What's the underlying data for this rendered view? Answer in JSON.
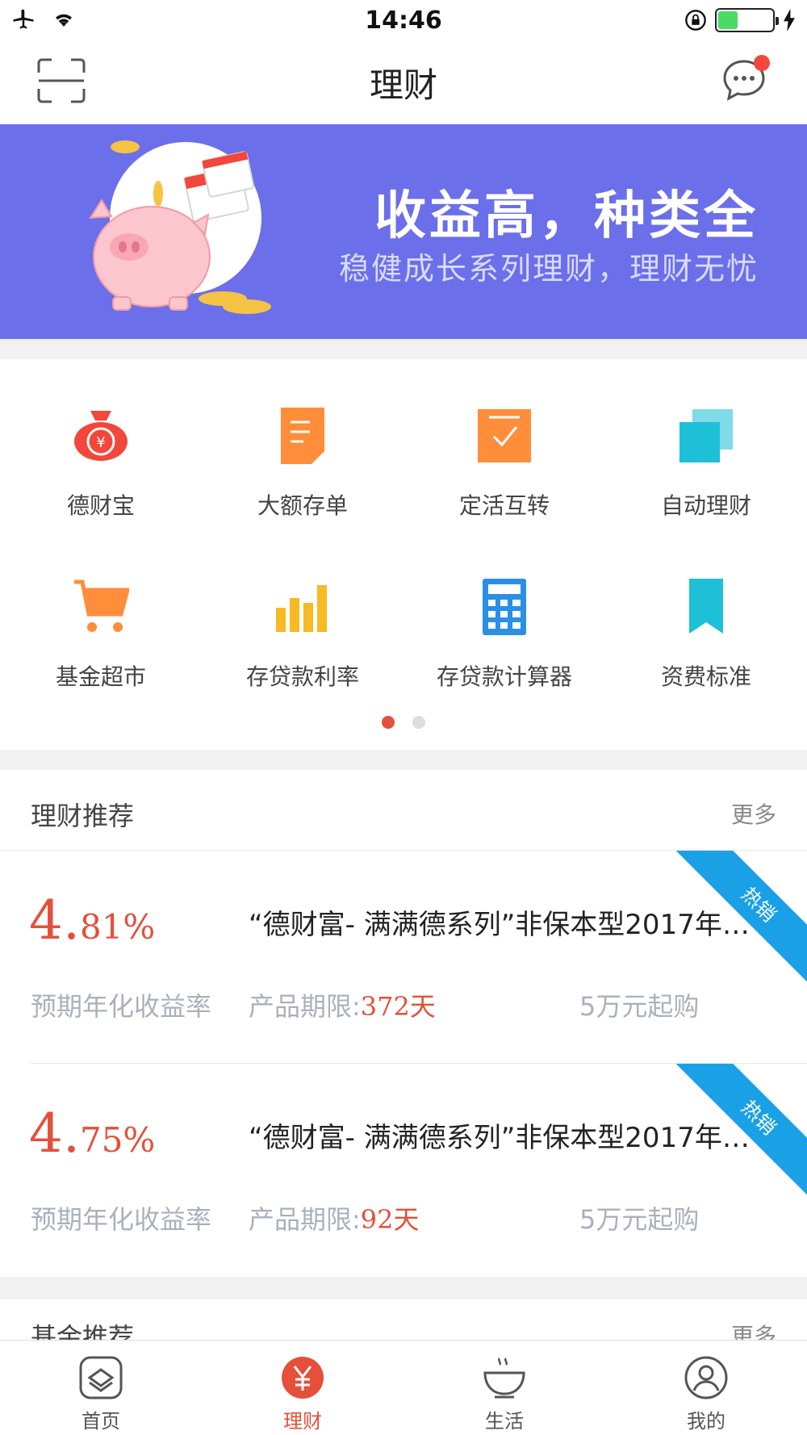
{
  "status_bar": {
    "time": "14:46"
  },
  "nav": {
    "title": "理财"
  },
  "banner": {
    "title": "收益高，种类全",
    "subtitle": "稳健成长系列理财，理财无忧"
  },
  "grid": {
    "items": [
      {
        "label": "德财宝",
        "icon": "money-bag-icon",
        "color": "#f2473a"
      },
      {
        "label": "大额存单",
        "icon": "document-icon",
        "color": "#ff8d3a"
      },
      {
        "label": "定活互转",
        "icon": "checkbox-icon",
        "color": "#ff8d3a"
      },
      {
        "label": "自动理财",
        "icon": "stack-icon",
        "color": "#1ec0d8"
      },
      {
        "label": "基金超市",
        "icon": "cart-icon",
        "color": "#ff8d3a"
      },
      {
        "label": "存贷款利率",
        "icon": "bar-chart-icon",
        "color": "#f7b924"
      },
      {
        "label": "存贷款计算器",
        "icon": "calculator-icon",
        "color": "#2b8fe6"
      },
      {
        "label": "资费标准",
        "icon": "bookmark-icon",
        "color": "#1ec0d8"
      }
    ],
    "page_count": 2,
    "active_page": 1
  },
  "recommend": {
    "title": "理财推荐",
    "more": "更多",
    "products": [
      {
        "rate_int": "4.",
        "rate_dec": "81%",
        "name": "“德财富- 满满德系列”非保本型2017年…",
        "rate_label": "预期年化收益率",
        "term_label": "产品期限:",
        "term_value": "372天",
        "min_buy": "5万元起购",
        "badge": "热销"
      },
      {
        "rate_int": "4.",
        "rate_dec": "75%",
        "name": "“德财富- 满满德系列”非保本型2017年…",
        "rate_label": "预期年化收益率",
        "term_label": "产品期限:",
        "term_value": "92天",
        "min_buy": "5万元起购",
        "badge": "热销"
      }
    ]
  },
  "fund": {
    "title": "基金推荐",
    "more": "更多"
  },
  "tabbar": {
    "tabs": [
      {
        "label": "首页",
        "icon": "home-icon"
      },
      {
        "label": "理财",
        "icon": "yuan-icon",
        "active": true
      },
      {
        "label": "生活",
        "icon": "bowl-icon"
      },
      {
        "label": "我的",
        "icon": "user-icon"
      }
    ]
  },
  "colors": {
    "accent": "#e4503a",
    "banner_bg": "#6b6fe9",
    "ribbon": "#1aa0e6"
  }
}
